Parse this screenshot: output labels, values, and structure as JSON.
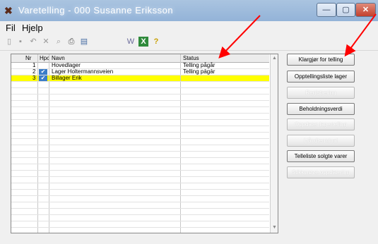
{
  "window": {
    "title": "Varetelling - 000 Susanne Eriksson",
    "min_glyph": "—",
    "max_glyph": "▢",
    "close_glyph": "✕"
  },
  "menu": [
    "Fil",
    "Hjelp"
  ],
  "toolbar": {
    "icons": [
      "new-icon",
      "save-icon",
      "undo-icon",
      "delete-icon",
      "find-icon",
      "print-icon",
      "calendar-icon",
      "word-icon",
      "excel-icon",
      "help-icon"
    ]
  },
  "grid": {
    "headers": {
      "nr": "Nr",
      "hpc": "Hpc",
      "navn": "Navn",
      "status": "Status"
    },
    "rows": [
      {
        "nr": "1",
        "hpc": "",
        "navn": "Hovedlager",
        "status": "Telling pågår",
        "selected": false
      },
      {
        "nr": "2",
        "hpc": "✔",
        "navn": "Lager Holtermannsveien",
        "status": "Telling pågår",
        "selected": false
      },
      {
        "nr": "3",
        "hpc": "✔",
        "navn": "Billager Erik",
        "status": "",
        "selected": true
      }
    ]
  },
  "buttons": [
    {
      "label": "Klargjør for telling",
      "enabled": true
    },
    {
      "label": "Opptellingsliste lager",
      "enabled": true
    },
    {
      "label": "Registrering",
      "enabled": false
    },
    {
      "label": "Beholdningsverdi",
      "enabled": true
    },
    {
      "label": "Oppdater lagertelling",
      "enabled": false
    },
    {
      "label": "Håndterminal",
      "enabled": false
    },
    {
      "label": "Telleliste solgte varer",
      "enabled": true
    },
    {
      "label": "Stikkprøve oppdatering",
      "enabled": false
    }
  ],
  "colors": {
    "selection": "#ffff00",
    "annotation_arrow": "#ff0000"
  }
}
